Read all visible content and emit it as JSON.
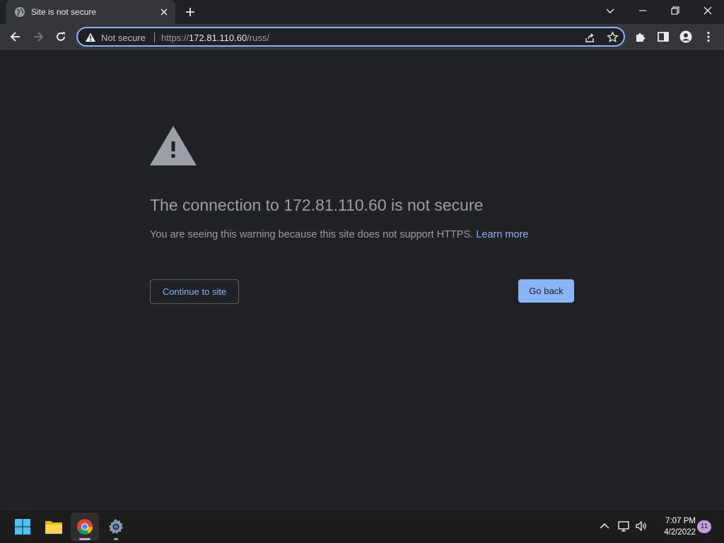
{
  "tab": {
    "title": "Site is not secure"
  },
  "omnibox": {
    "security_label": "Not secure",
    "url_scheme": "https://",
    "url_host": "172.81.110.60",
    "url_path": "/russ/"
  },
  "page": {
    "headline": "The connection to 172.81.110.60 is not secure",
    "explanation": "You are seeing this warning because this site does not support HTTPS.",
    "learn_more": "Learn more",
    "continue_label": "Continue to site",
    "back_label": "Go back"
  },
  "taskbar": {
    "apps": [
      "start-icon",
      "file-explorer-icon",
      "chrome-icon",
      "settings-icon"
    ],
    "time": "7:07 PM",
    "date": "4/2/2022",
    "notification_count": "11"
  },
  "colors": {
    "background": "#202124",
    "accent": "#8ab4f8",
    "toolbar": "#35363a",
    "taskbar": "#1c1c1c"
  }
}
